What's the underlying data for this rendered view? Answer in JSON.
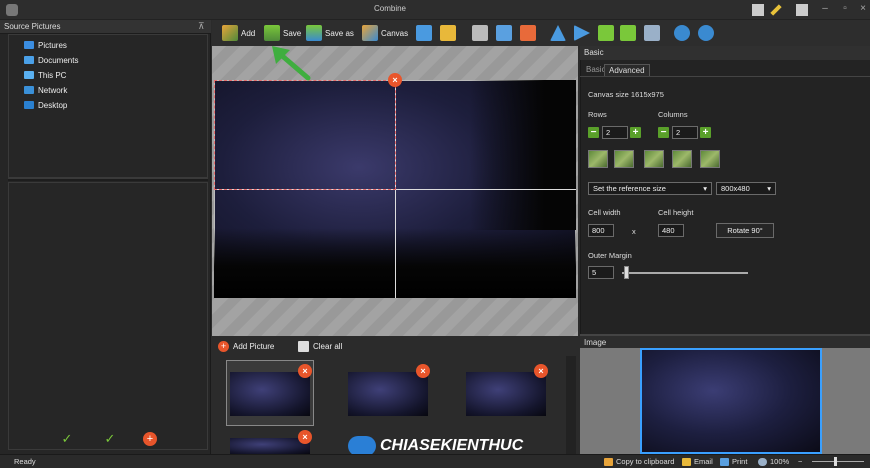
{
  "window": {
    "title": "Combine"
  },
  "source_panel": {
    "title": "Source Pictures",
    "items": [
      {
        "label": "Pictures",
        "icon": "pictures-folder-icon",
        "color": "#3b8de0"
      },
      {
        "label": "Documents",
        "icon": "documents-folder-icon",
        "color": "#4aa0e8"
      },
      {
        "label": "This PC",
        "icon": "computer-icon",
        "color": "#5ab0f0"
      },
      {
        "label": "Network",
        "icon": "network-icon",
        "color": "#3a90d8"
      },
      {
        "label": "Desktop",
        "icon": "desktop-icon",
        "color": "#2a80d0"
      }
    ]
  },
  "toolbar": {
    "add_label": "Add",
    "save_label": "Save",
    "save_as_label": "Save as",
    "canvas_label": "Canvas"
  },
  "picture_panel": {
    "add_picture_label": "Add Picture",
    "clear_all_label": "Clear all"
  },
  "basic_panel": {
    "title": "Basic",
    "tabs": [
      "Basic",
      "Advanced"
    ],
    "canvas_size": "Canvas size 1615x975",
    "rows_label": "Rows",
    "rows_value": "2",
    "columns_label": "Columns",
    "columns_value": "2",
    "reference_mode": "Set the reference size",
    "reference_size": "800x480",
    "cell_width_label": "Cell width",
    "cell_width_value": "800",
    "times": "x",
    "cell_height_label": "Cell height",
    "cell_height_value": "480",
    "rotate_label": "Rotate 90°",
    "outer_margin_label": "Outer Margin",
    "outer_margin_value": "5"
  },
  "image_panel": {
    "title": "Image"
  },
  "statusbar": {
    "status": "Ready",
    "copy_label": "Copy to clipboard",
    "email_label": "Email",
    "print_label": "Print",
    "zoom": "100%",
    "zoom_out": "−"
  },
  "watermark": {
    "text": "CHIASEKIENTHUC"
  },
  "colors": {
    "accent": "#e8552b",
    "selection": "#3aa0ff",
    "arrow": "#3fae3f"
  }
}
